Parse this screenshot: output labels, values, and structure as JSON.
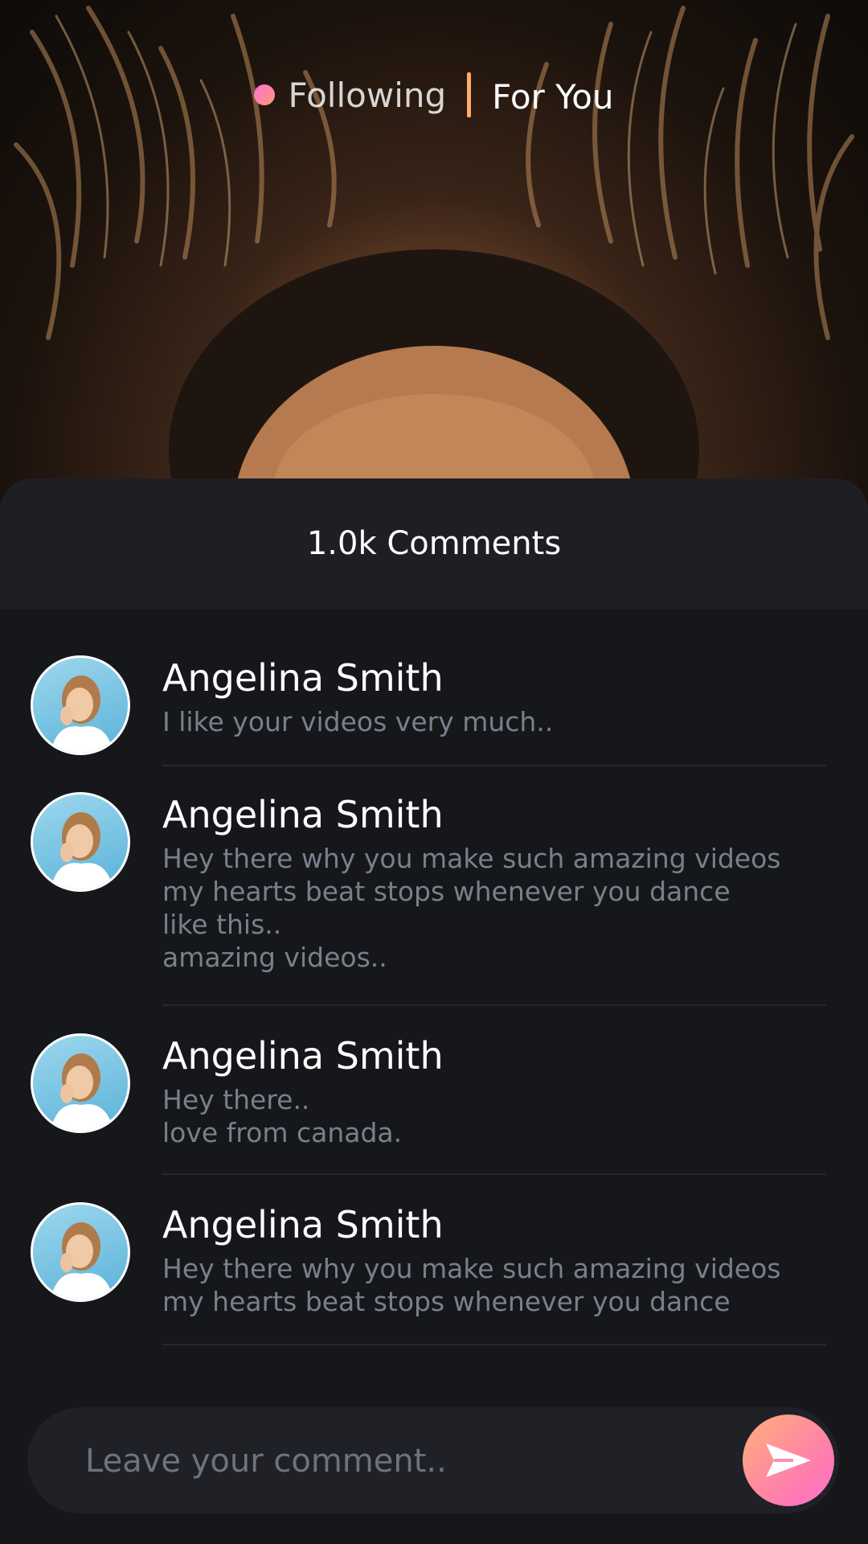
{
  "top_nav": {
    "following_label": "Following",
    "for_you_label": "For You"
  },
  "comments_sheet": {
    "title": "1.0k Comments",
    "comments": [
      {
        "author": "Angelina Smith",
        "text": "I like your videos very much.."
      },
      {
        "author": "Angelina Smith",
        "text": "Hey there why you make such amazing videos\nmy hearts beat stops whenever you dance\nlike this..\namazing videos.."
      },
      {
        "author": "Angelina Smith",
        "text": "Hey there..\nlove from canada."
      },
      {
        "author": "Angelina Smith",
        "text": "Hey there why you make such amazing videos\nmy hearts beat stops whenever you dance"
      }
    ]
  },
  "composer": {
    "placeholder": "Leave your comment..",
    "send_icon": "send-icon"
  },
  "colors": {
    "accent_gradient_start": "#ffb07a",
    "accent_gradient_end": "#ff6fd0",
    "divider_accent": "#ffab6b",
    "sheet_background": "#16171b",
    "header_background": "#1e1f24",
    "comment_text": "#7b7f8c"
  }
}
